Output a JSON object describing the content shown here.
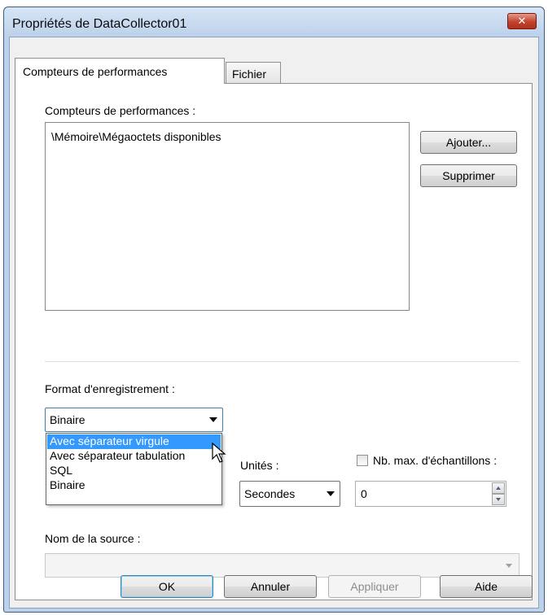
{
  "window": {
    "title": "Propriétés de DataCollector01",
    "close_label": "✕"
  },
  "tabs": [
    {
      "label": "Compteurs de performances",
      "active": true
    },
    {
      "label": "Fichier",
      "active": false
    }
  ],
  "counters": {
    "label": "Compteurs de performances :",
    "items": [
      "\\Mémoire\\Mégaoctets disponibles"
    ],
    "add_button": "Ajouter...",
    "remove_button": "Supprimer"
  },
  "log_format": {
    "label": "Format d'enregistrement :",
    "selected": "Binaire",
    "options": [
      "Avec séparateur virgule",
      "Avec séparateur tabulation",
      "SQL",
      "Binaire"
    ],
    "highlighted_index": 0
  },
  "units": {
    "label": "Unités :",
    "selected": "Secondes"
  },
  "max_samples": {
    "label": "Nb. max. d'échantillons :",
    "checked": false,
    "value": "0"
  },
  "source": {
    "label": "Nom de la source :",
    "value": ""
  },
  "footer": {
    "ok": "OK",
    "cancel": "Annuler",
    "apply": "Appliquer",
    "help": "Aide"
  },
  "colors": {
    "accent": "#3399ff",
    "frame": "#bcd1ea",
    "close": "#c2422d"
  }
}
